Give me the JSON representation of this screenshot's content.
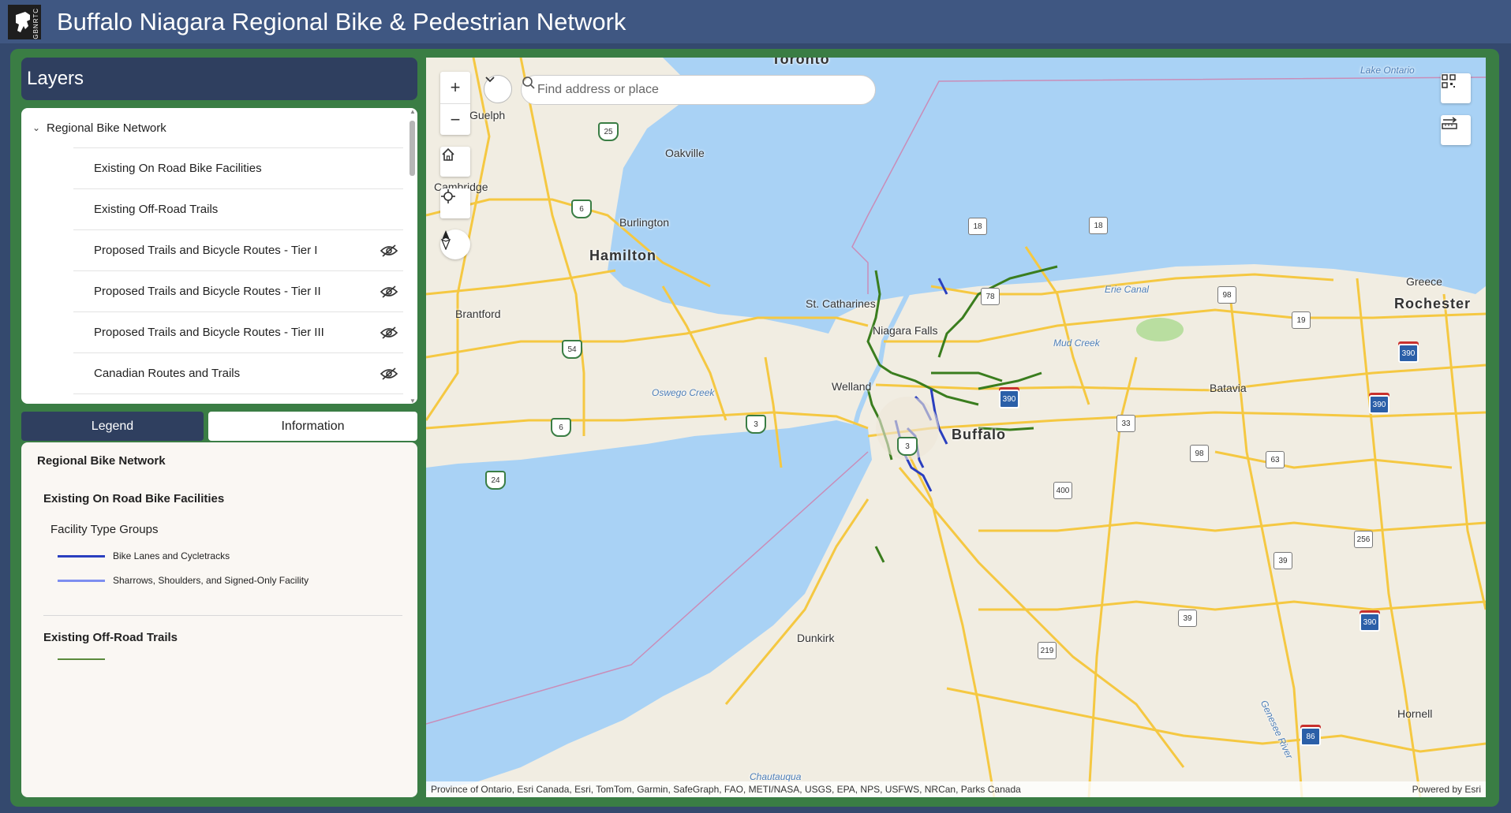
{
  "app": {
    "title": "Buffalo Niagara Regional Bike & Pedestrian Network",
    "logo_text": "GBNRTC"
  },
  "layers": {
    "heading": "Layers",
    "group": "Regional Bike Network",
    "items": [
      {
        "label": "Existing On Road Bike Facilities",
        "hidden": false
      },
      {
        "label": "Existing Off-Road Trails",
        "hidden": false
      },
      {
        "label": "Proposed Trails and Bicycle Routes - Tier I",
        "hidden": true
      },
      {
        "label": "Proposed Trails and Bicycle Routes - Tier II",
        "hidden": true
      },
      {
        "label": "Proposed Trails and Bicycle Routes - Tier III",
        "hidden": true
      },
      {
        "label": "Canadian Routes and Trails",
        "hidden": true
      }
    ]
  },
  "tabs": {
    "legend": "Legend",
    "information": "Information"
  },
  "legend": {
    "title": "Regional Bike Network",
    "section1": "Existing On Road Bike Facilities",
    "group_label": "Facility Type Groups",
    "items": [
      {
        "label": "Bike Lanes and Cycletracks",
        "color": "#2a3fbf"
      },
      {
        "label": "Sharrows, Shoulders, and Signed-Only Facility",
        "color": "#7d8ef0"
      }
    ],
    "section2": "Existing Off-Road Trails"
  },
  "map": {
    "search_placeholder": "Find address or place",
    "attribution": "Province of Ontario, Esri Canada, Esri, TomTom, Garmin, SafeGraph, FAO, METI/NASA, USGS, EPA, NPS, USFWS, NRCan, Parks Canada",
    "powered_by": "Powered by Esri",
    "colors": {
      "water": "#a9d2f5",
      "land": "#f1ede2",
      "road": "#f5c842",
      "trail": "#3a7d1e",
      "bike": "#2a3fbf"
    },
    "places": {
      "toronto": "Toronto",
      "guelph": "Guelph",
      "oakville": "Oakville",
      "cambridge": "Cambridge",
      "burlington": "Burlington",
      "hamilton": "Hamilton",
      "brantford": "Brantford",
      "st_catharines": "St. Catharines",
      "niagara_falls": "Niagara Falls",
      "welland": "Welland",
      "buffalo": "Buffalo",
      "batavia": "Batavia",
      "rochester": "Rochester",
      "greece": "Greece",
      "dunkirk": "Dunkirk",
      "hornell": "Hornell",
      "lake_ontario": "Lake Ontario",
      "erie_canal": "Erie Canal",
      "mud_creek": "Mud Creek",
      "oswego_creek": "Oswego Creek",
      "genesee_river": "Genesee River",
      "chautauqua": "Chautauqua"
    },
    "shields": [
      "25",
      "6",
      "54",
      "6",
      "24",
      "3",
      "3",
      "18",
      "18",
      "78",
      "98",
      "19",
      "33",
      "98",
      "63",
      "400",
      "256",
      "39",
      "39",
      "219",
      "390",
      "390",
      "390",
      "390",
      "86"
    ]
  }
}
